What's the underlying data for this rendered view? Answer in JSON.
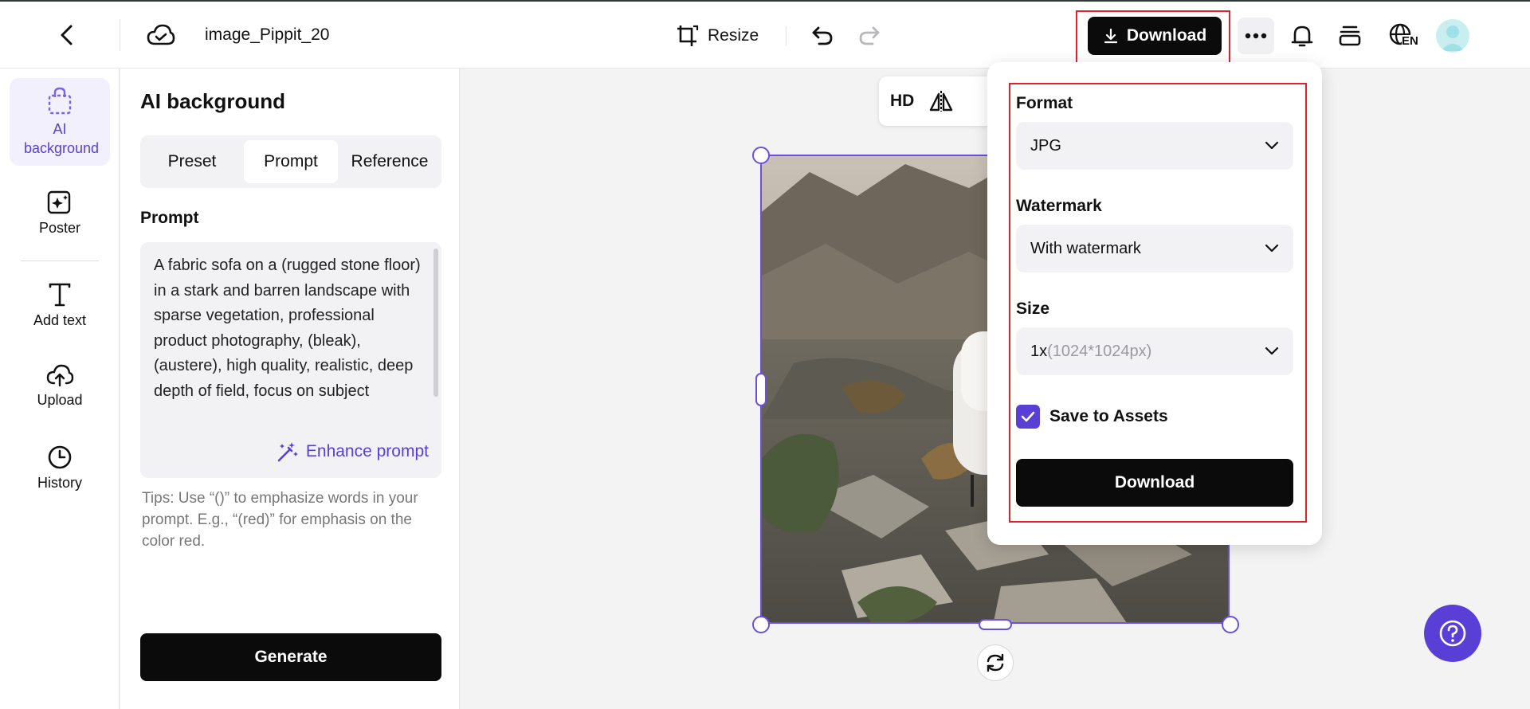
{
  "header": {
    "doc_title": "image_Pippit_20",
    "resize_label": "Resize",
    "download_label": "Download",
    "lang_badge": "EN"
  },
  "leftnav": {
    "items": [
      {
        "label": "AI background"
      },
      {
        "label": "Poster"
      },
      {
        "label": "Add text"
      },
      {
        "label": "Upload"
      },
      {
        "label": "History"
      }
    ]
  },
  "panel": {
    "title": "AI background",
    "tabs": [
      "Preset",
      "Prompt",
      "Reference"
    ],
    "active_tab": "Prompt",
    "prompt_label": "Prompt",
    "prompt_text": "A fabric sofa on a (rugged stone floor) in a stark and barren landscape with sparse vegetation, professional product photography, (bleak), (austere), high quality, realistic, deep depth of field, focus on subject",
    "enhance_label": "Enhance prompt",
    "tips": "Tips: Use “()” to emphasize words in your prompt. E.g., “(red)” for emphasis on the color red.",
    "generate_label": "Generate"
  },
  "canvas": {
    "hd_label": "HD"
  },
  "download_menu": {
    "format_label": "Format",
    "format_value": "JPG",
    "watermark_label": "Watermark",
    "watermark_value": "With watermark",
    "size_label": "Size",
    "size_value": "1x",
    "size_detail": "(1024*1024px)",
    "save_assets_label": "Save to Assets",
    "save_assets_checked": true,
    "download_label": "Download"
  },
  "colors": {
    "accent": "#5a3fd6",
    "primary_button": "#0b0b0b",
    "highlight": "#e0202a"
  }
}
